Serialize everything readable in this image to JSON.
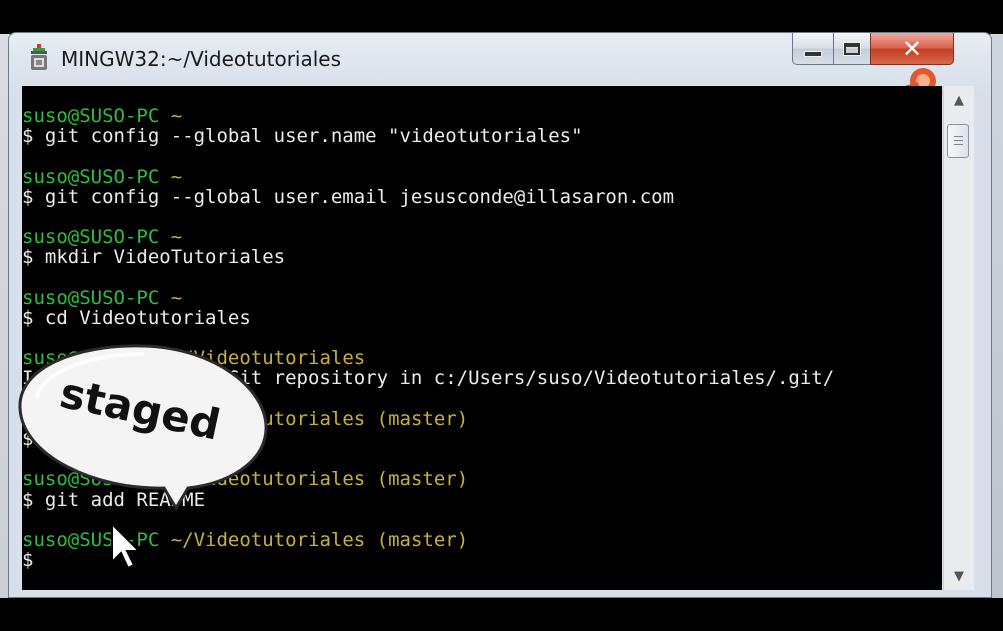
{
  "window": {
    "title": "MINGW32:~/Videotutoriales",
    "app_icon": "git-bash-icon",
    "caption_buttons": [
      "minimize",
      "maximize",
      "close"
    ]
  },
  "console": {
    "lines": [
      {
        "kind": "prompt",
        "user": "suso@SUSO-PC",
        "path": "~",
        "branch": ""
      },
      {
        "kind": "command",
        "text": "$ git config --global user.name \"videotutoriales\""
      },
      {
        "kind": "blank",
        "text": ""
      },
      {
        "kind": "prompt",
        "user": "suso@SUSO-PC",
        "path": "~",
        "branch": ""
      },
      {
        "kind": "command",
        "text": "$ git config --global user.email jesusconde@illasaron.com"
      },
      {
        "kind": "blank",
        "text": ""
      },
      {
        "kind": "prompt",
        "user": "suso@SUSO-PC",
        "path": "~",
        "branch": ""
      },
      {
        "kind": "command",
        "text": "$ mkdir VideoTutoriales"
      },
      {
        "kind": "blank",
        "text": ""
      },
      {
        "kind": "prompt",
        "user": "suso@SUSO-PC",
        "path": "~",
        "branch": ""
      },
      {
        "kind": "command",
        "text": "$ cd Videotutoriales"
      },
      {
        "kind": "blank",
        "text": ""
      },
      {
        "kind": "prompt",
        "user": "suso@SUSO-PC",
        "path": "~/Videotutoriales",
        "branch": ""
      },
      {
        "kind": "command",
        "text": "Initialized empty Git repository in c:/Users/suso/Videotutoriales/.git/"
      },
      {
        "kind": "blank",
        "text": ""
      },
      {
        "kind": "prompt",
        "user": "suso@SUSO-PC",
        "path": "~/Videotutoriales",
        "branch": "(master)"
      },
      {
        "kind": "command",
        "text": "$ touch README"
      },
      {
        "kind": "blank",
        "text": ""
      },
      {
        "kind": "prompt",
        "user": "suso@SUSO-PC",
        "path": "~/Videotutoriales",
        "branch": "(master)"
      },
      {
        "kind": "command",
        "text": "$ git add README"
      },
      {
        "kind": "blank",
        "text": ""
      },
      {
        "kind": "prompt",
        "user": "suso@SUSO-PC",
        "path": "~/Videotutoriales",
        "branch": "(master)"
      },
      {
        "kind": "command",
        "text": "$"
      }
    ]
  },
  "overlay": {
    "bubble_text": "staged"
  },
  "scrollbar": {
    "up_icon": "arrow-up-icon",
    "down_icon": "arrow-down-icon"
  }
}
